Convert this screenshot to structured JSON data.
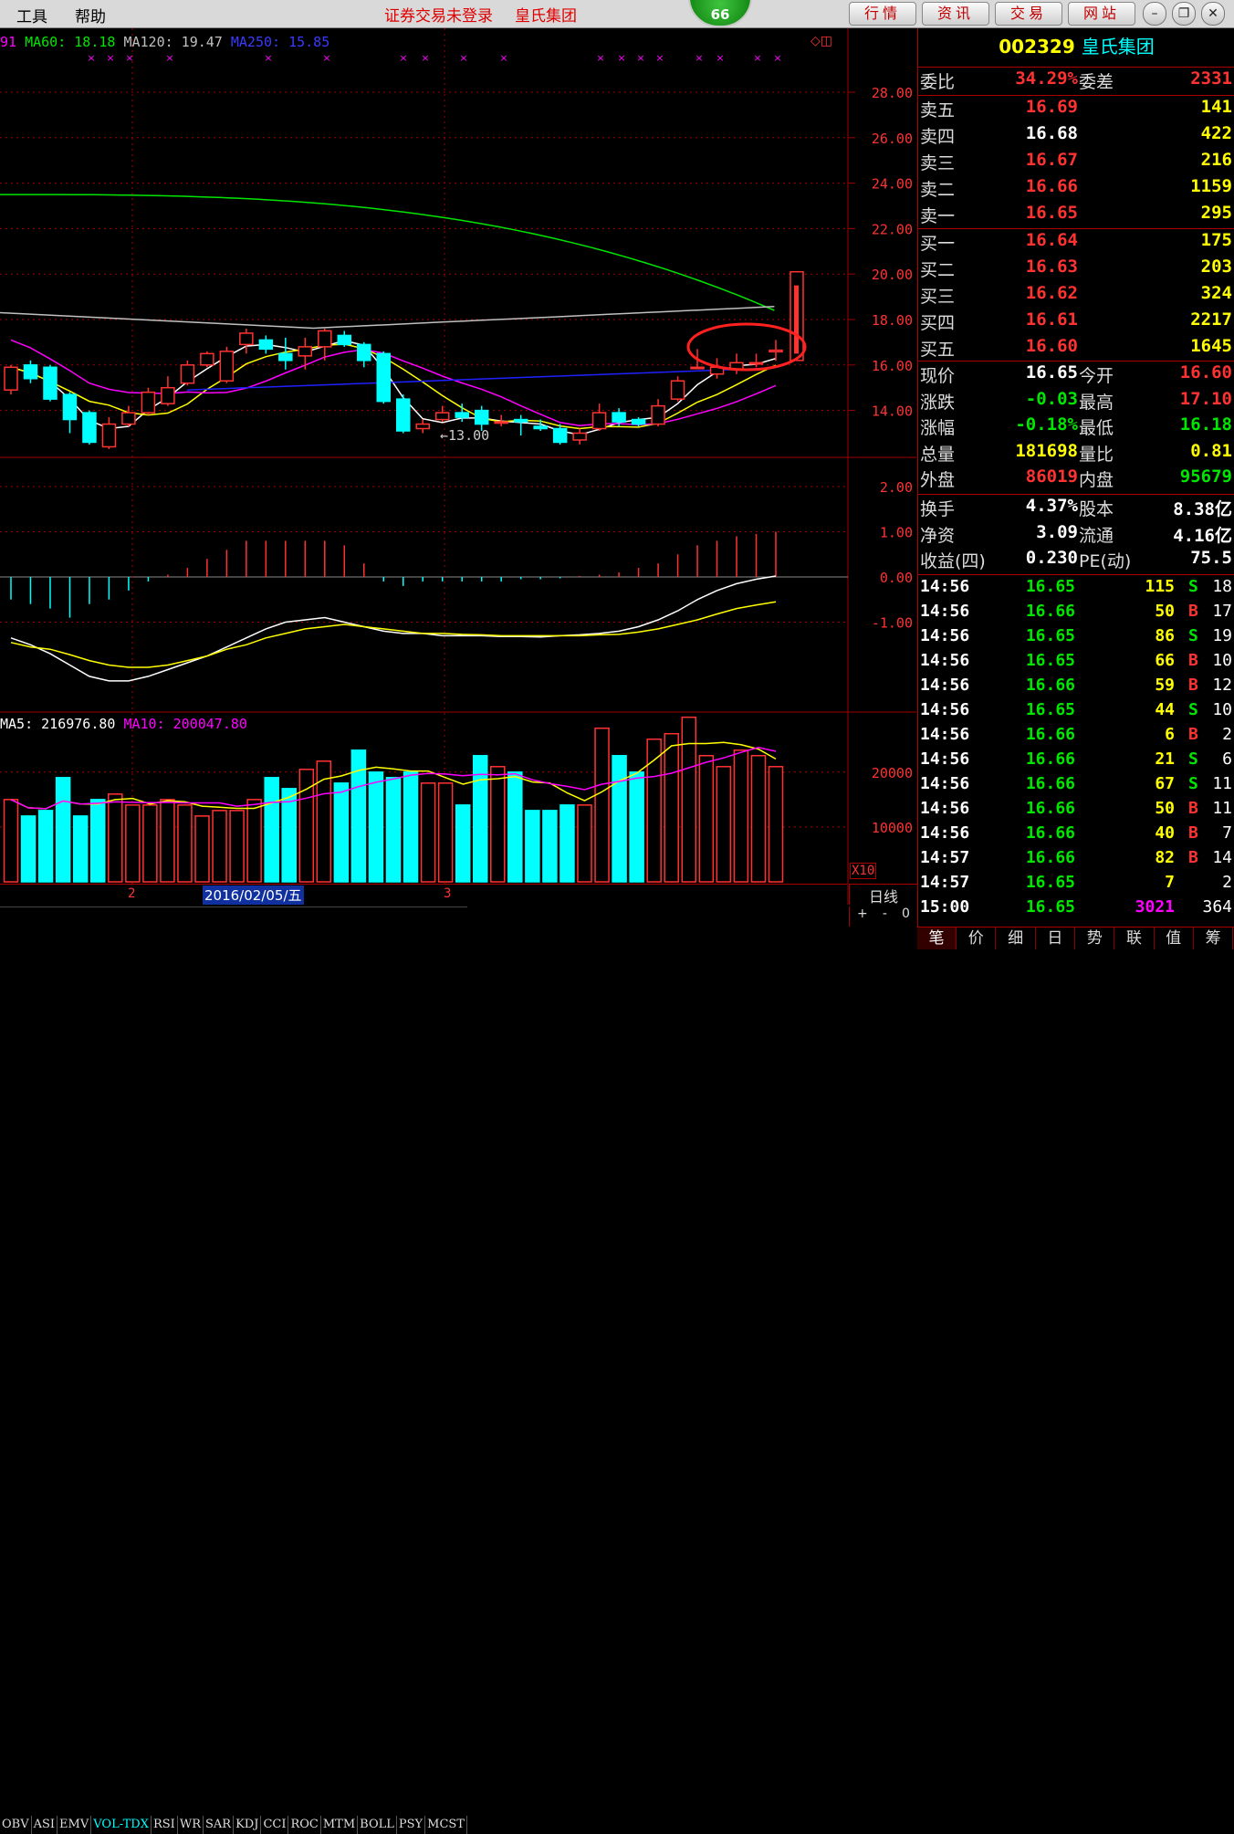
{
  "menu": {
    "tools": "工具",
    "help": "帮助"
  },
  "title": {
    "status": "证券交易未登录",
    "stock": "皇氏集团"
  },
  "badge": "66",
  "top_buttons": [
    "行情",
    "资讯",
    "交易",
    "网站"
  ],
  "window_icons": [
    "minimize-icon",
    "restore-icon",
    "close-icon"
  ],
  "ma_legend": {
    "ma_prefix": "91",
    "ma60": "MA60: 18.18",
    "ma120": "MA120: 19.47",
    "ma250": "MA250: 15.85"
  },
  "price_axis": [
    "28.00",
    "26.00",
    "24.00",
    "22.00",
    "20.00",
    "18.00",
    "16.00",
    "14.00"
  ],
  "low_label": "←13.00",
  "macd_axis": [
    "2.00",
    "1.00",
    "0.00",
    "-1.00"
  ],
  "vol_legend": {
    "ma5": "MA5: 216976.80",
    "ma10": "MA10: 200047.80"
  },
  "vol_axis": [
    "20000",
    "10000"
  ],
  "vol_unit": "X10",
  "date_axis": {
    "m2": "2",
    "date": "2016/02/05/五",
    "m3": "3"
  },
  "period": "日线",
  "zoom_controls": {
    "plus": "+",
    "minus": "-",
    "zero": "0"
  },
  "indicator_tabs": [
    "OBV",
    "ASI",
    "EMV",
    "VOL-TDX",
    "RSI",
    "WR",
    "SAR",
    "KDJ",
    "CCI",
    "ROC",
    "MTM",
    "BOLL",
    "PSY",
    "MCST"
  ],
  "active_indicator": "VOL-TDX",
  "colors": {
    "up": "#ff3232",
    "down": "#00ffff",
    "ma5": "#ffffff",
    "ma10": "#ffff00",
    "ma20": "#ff00ff",
    "ma60": "#00e600",
    "ma120": "#c0c0c0",
    "ma250": "#2020ff",
    "grid": "#a00000"
  },
  "candles": [
    [
      14.9,
      15.9,
      16.0,
      14.7
    ],
    [
      16.0,
      15.4,
      16.2,
      15.2
    ],
    [
      15.9,
      14.5,
      16.0,
      14.4
    ],
    [
      14.7,
      13.6,
      14.8,
      13.0
    ],
    [
      13.9,
      12.6,
      14.0,
      12.5
    ],
    [
      12.4,
      13.4,
      13.7,
      12.3
    ],
    [
      13.4,
      13.9,
      14.2,
      13.3
    ],
    [
      13.9,
      14.8,
      15.0,
      13.8
    ],
    [
      14.3,
      15.0,
      15.5,
      14.2
    ],
    [
      15.2,
      16.0,
      16.2,
      15.1
    ],
    [
      16.0,
      16.5,
      16.6,
      15.9
    ],
    [
      15.3,
      16.6,
      16.8,
      15.2
    ],
    [
      16.9,
      17.4,
      17.6,
      16.5
    ],
    [
      17.1,
      16.7,
      17.3,
      16.5
    ],
    [
      16.5,
      16.2,
      17.2,
      15.8
    ],
    [
      16.4,
      16.8,
      17.2,
      15.8
    ],
    [
      16.8,
      17.5,
      17.6,
      16.2
    ],
    [
      17.3,
      16.9,
      17.5,
      16.8
    ],
    [
      16.9,
      16.2,
      17.0,
      15.9
    ],
    [
      16.5,
      14.4,
      16.6,
      14.3
    ],
    [
      14.5,
      13.1,
      14.7,
      13.0
    ],
    [
      13.2,
      13.4,
      13.6,
      13.0
    ],
    [
      13.6,
      13.9,
      14.2,
      13.5
    ],
    [
      13.9,
      13.7,
      14.3,
      13.5
    ],
    [
      14.0,
      13.4,
      14.2,
      13.1
    ],
    [
      13.5,
      13.5,
      13.8,
      13.3
    ],
    [
      13.6,
      13.5,
      13.8,
      12.9
    ],
    [
      13.3,
      13.2,
      13.6,
      13.1
    ],
    [
      13.2,
      12.6,
      13.4,
      12.5
    ],
    [
      12.7,
      13.0,
      13.2,
      12.5
    ],
    [
      13.2,
      13.9,
      14.3,
      13.1
    ],
    [
      13.9,
      13.5,
      14.1,
      13.3
    ],
    [
      13.6,
      13.4,
      13.7,
      13.3
    ],
    [
      13.4,
      14.2,
      14.5,
      13.3
    ],
    [
      14.5,
      15.3,
      15.5,
      14.4
    ],
    [
      15.9,
      15.9,
      16.7,
      15.9
    ],
    [
      15.6,
      15.9,
      16.3,
      15.4
    ],
    [
      15.8,
      16.1,
      16.5,
      15.6
    ],
    [
      16.1,
      16.1,
      16.5,
      15.9
    ],
    [
      16.58,
      16.65,
      17.1,
      16.18
    ]
  ],
  "macd_hist": [
    -0.5,
    -0.6,
    -0.7,
    -0.9,
    -0.6,
    -0.5,
    -0.3,
    -0.1,
    0.05,
    0.2,
    0.4,
    0.6,
    0.8,
    0.8,
    0.8,
    0.8,
    0.8,
    0.7,
    0.3,
    -0.1,
    -0.2,
    -0.1,
    -0.1,
    -0.1,
    -0.1,
    -0.1,
    -0.05,
    -0.05,
    -0.03,
    0.02,
    0.05,
    0.1,
    0.2,
    0.3,
    0.5,
    0.7,
    0.8,
    0.9,
    0.95,
    1.0
  ],
  "volumes": [
    15000,
    12000,
    13000,
    19000,
    12000,
    15000,
    16000,
    14000,
    14000,
    15000,
    14000,
    12000,
    13000,
    13000,
    15000,
    19000,
    17000,
    20500,
    22000,
    18000,
    24000,
    20000,
    19000,
    20000,
    18000,
    18000,
    14000,
    23000,
    21000,
    20000,
    13000,
    13000,
    14000,
    14000,
    28000,
    23000,
    20000,
    26000,
    27000,
    30000,
    23000,
    21000,
    24000,
    23000,
    21000
  ],
  "code": "002329",
  "name": "皇氏集团",
  "ratio": {
    "label": "委比",
    "value": "34.29%",
    "label2": "委差",
    "value2": "2331"
  },
  "asks": [
    {
      "label": "卖五",
      "price": "16.69",
      "vol": "141"
    },
    {
      "label": "卖四",
      "price": "16.68",
      "vol": "422"
    },
    {
      "label": "卖三",
      "price": "16.67",
      "vol": "216"
    },
    {
      "label": "卖二",
      "price": "16.66",
      "vol": "1159"
    },
    {
      "label": "卖一",
      "price": "16.65",
      "vol": "295"
    }
  ],
  "bids": [
    {
      "label": "买一",
      "price": "16.64",
      "vol": "175"
    },
    {
      "label": "买二",
      "price": "16.63",
      "vol": "203"
    },
    {
      "label": "买三",
      "price": "16.62",
      "vol": "324"
    },
    {
      "label": "买四",
      "price": "16.61",
      "vol": "2217"
    },
    {
      "label": "买五",
      "price": "16.60",
      "vol": "1645"
    }
  ],
  "quote": [
    {
      "l1": "现价",
      "v1": "16.65",
      "c1": "white",
      "l2": "今开",
      "v2": "16.60",
      "c2": "red"
    },
    {
      "l1": "涨跌",
      "v1": "-0.03",
      "c1": "green",
      "l2": "最高",
      "v2": "17.10",
      "c2": "red"
    },
    {
      "l1": "涨幅",
      "v1": "-0.18%",
      "c1": "green",
      "l2": "最低",
      "v2": "16.18",
      "c2": "green"
    },
    {
      "l1": "总量",
      "v1": "181698",
      "c1": "yellow",
      "l2": "量比",
      "v2": "0.81",
      "c2": "yellow"
    },
    {
      "l1": "外盘",
      "v1": "86019",
      "c1": "red",
      "l2": "内盘",
      "v2": "95679",
      "c2": "green"
    }
  ],
  "finance": [
    {
      "l1": "换手",
      "v1": "4.37%",
      "l2": "股本",
      "v2": "8.38亿"
    },
    {
      "l1": "净资",
      "v1": "3.09",
      "l2": "流通",
      "v2": "4.16亿"
    },
    {
      "l1": "收益(四)",
      "v1": "0.230",
      "l2": "PE(动)",
      "v2": "75.5"
    }
  ],
  "ticks": [
    {
      "t": "14:56",
      "p": "16.65",
      "v": "115",
      "s": "S",
      "n": "18"
    },
    {
      "t": "14:56",
      "p": "16.66",
      "v": "50",
      "s": "B",
      "n": "17"
    },
    {
      "t": "14:56",
      "p": "16.65",
      "v": "86",
      "s": "S",
      "n": "19"
    },
    {
      "t": "14:56",
      "p": "16.65",
      "v": "66",
      "s": "B",
      "n": "10"
    },
    {
      "t": "14:56",
      "p": "16.66",
      "v": "59",
      "s": "B",
      "n": "12"
    },
    {
      "t": "14:56",
      "p": "16.65",
      "v": "44",
      "s": "S",
      "n": "10"
    },
    {
      "t": "14:56",
      "p": "16.66",
      "v": "6",
      "s": "B",
      "n": "2"
    },
    {
      "t": "14:56",
      "p": "16.66",
      "v": "21",
      "s": "S",
      "n": "6"
    },
    {
      "t": "14:56",
      "p": "16.66",
      "v": "67",
      "s": "S",
      "n": "11"
    },
    {
      "t": "14:56",
      "p": "16.66",
      "v": "50",
      "s": "B",
      "n": "11"
    },
    {
      "t": "14:56",
      "p": "16.66",
      "v": "40",
      "s": "B",
      "n": "7"
    },
    {
      "t": "14:57",
      "p": "16.66",
      "v": "82",
      "s": "B",
      "n": "14"
    },
    {
      "t": "14:57",
      "p": "16.65",
      "v": "7",
      "s": "",
      "n": "2"
    },
    {
      "t": "15:00",
      "p": "16.65",
      "v": "3021",
      "s": "",
      "n": "364"
    }
  ],
  "bottom_tabs": [
    "笔",
    "价",
    "细",
    "日",
    "势",
    "联",
    "值",
    "筹"
  ]
}
